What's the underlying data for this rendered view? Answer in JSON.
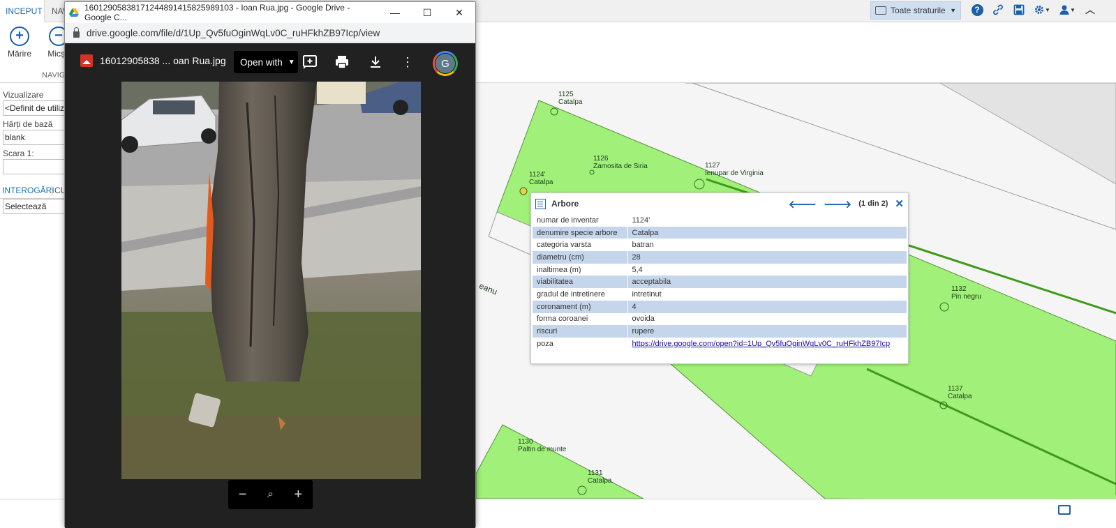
{
  "app": {
    "tabs": [
      {
        "label": "INCEPUT"
      },
      {
        "label": "NAV"
      }
    ],
    "layers_button": "Toate straturile",
    "ribbon": {
      "zoom_in": "Mărire",
      "zoom_out": "Micșo",
      "group_label": "NAVIG"
    },
    "left_panel": {
      "view_label": "Vizualizare",
      "view_value": "<Definit de utiliz",
      "basemap_label": "Hărți de bază",
      "basemap_value": "blank",
      "scale_label": "Scara 1:",
      "scale_value": "",
      "tab_query": "INTEROGĂRI",
      "tab_other": "CU",
      "select_value": "Selectează"
    }
  },
  "map": {
    "labels": [
      {
        "id": "1125",
        "name": "Catalpa"
      },
      {
        "id": "1126",
        "name": "Zamosita de Siria"
      },
      {
        "id": "1127",
        "name": "Ienupar de Virginia"
      },
      {
        "id": "1124'",
        "name": "Catalpa"
      },
      {
        "id": "1132",
        "name": "Pin negru"
      },
      {
        "id": "1137",
        "name": "Catalpa"
      },
      {
        "id": "1130",
        "name": "Paltin de munte"
      },
      {
        "id": "1131",
        "name": "Catalpa."
      }
    ],
    "street_fragment": "eanu",
    "colors": {
      "park": "#a0f07a",
      "park_border": "#5a8f3a",
      "line": "#3f9a1a"
    }
  },
  "popup": {
    "title": "Arbore",
    "counter": "(1 din 2)",
    "rows": [
      {
        "k": "numar de inventar",
        "v": "1124'"
      },
      {
        "k": "denumire specie arbore",
        "v": "Catalpa"
      },
      {
        "k": "categoria varsta",
        "v": "batran"
      },
      {
        "k": "diametru (cm)",
        "v": "28"
      },
      {
        "k": "inaltimea (m)",
        "v": "5,4"
      },
      {
        "k": "viabilitatea",
        "v": "acceptabila"
      },
      {
        "k": "gradul de intretinere",
        "v": "intretinut"
      },
      {
        "k": "coronament (m)",
        "v": "4"
      },
      {
        "k": "forma coroanei",
        "v": "ovoida"
      },
      {
        "k": "riscuri",
        "v": "rupere"
      },
      {
        "k": "poza",
        "v": "https://drive.google.com/open?id=1Up_Qv5fuOginWqLv0C_ruHFkhZB97Icp"
      }
    ]
  },
  "browser": {
    "title": "16012905838171244891415825989103 - Ioan Rua.jpg - Google Drive - Google C...",
    "url": "drive.google.com/file/d/1Up_Qv5fuOginWqLv0C_ruHFkhZB97Icp/view",
    "file_name": "16012905838 ... oan Rua.jpg",
    "open_with": "Open with",
    "avatar_letter": "G"
  }
}
